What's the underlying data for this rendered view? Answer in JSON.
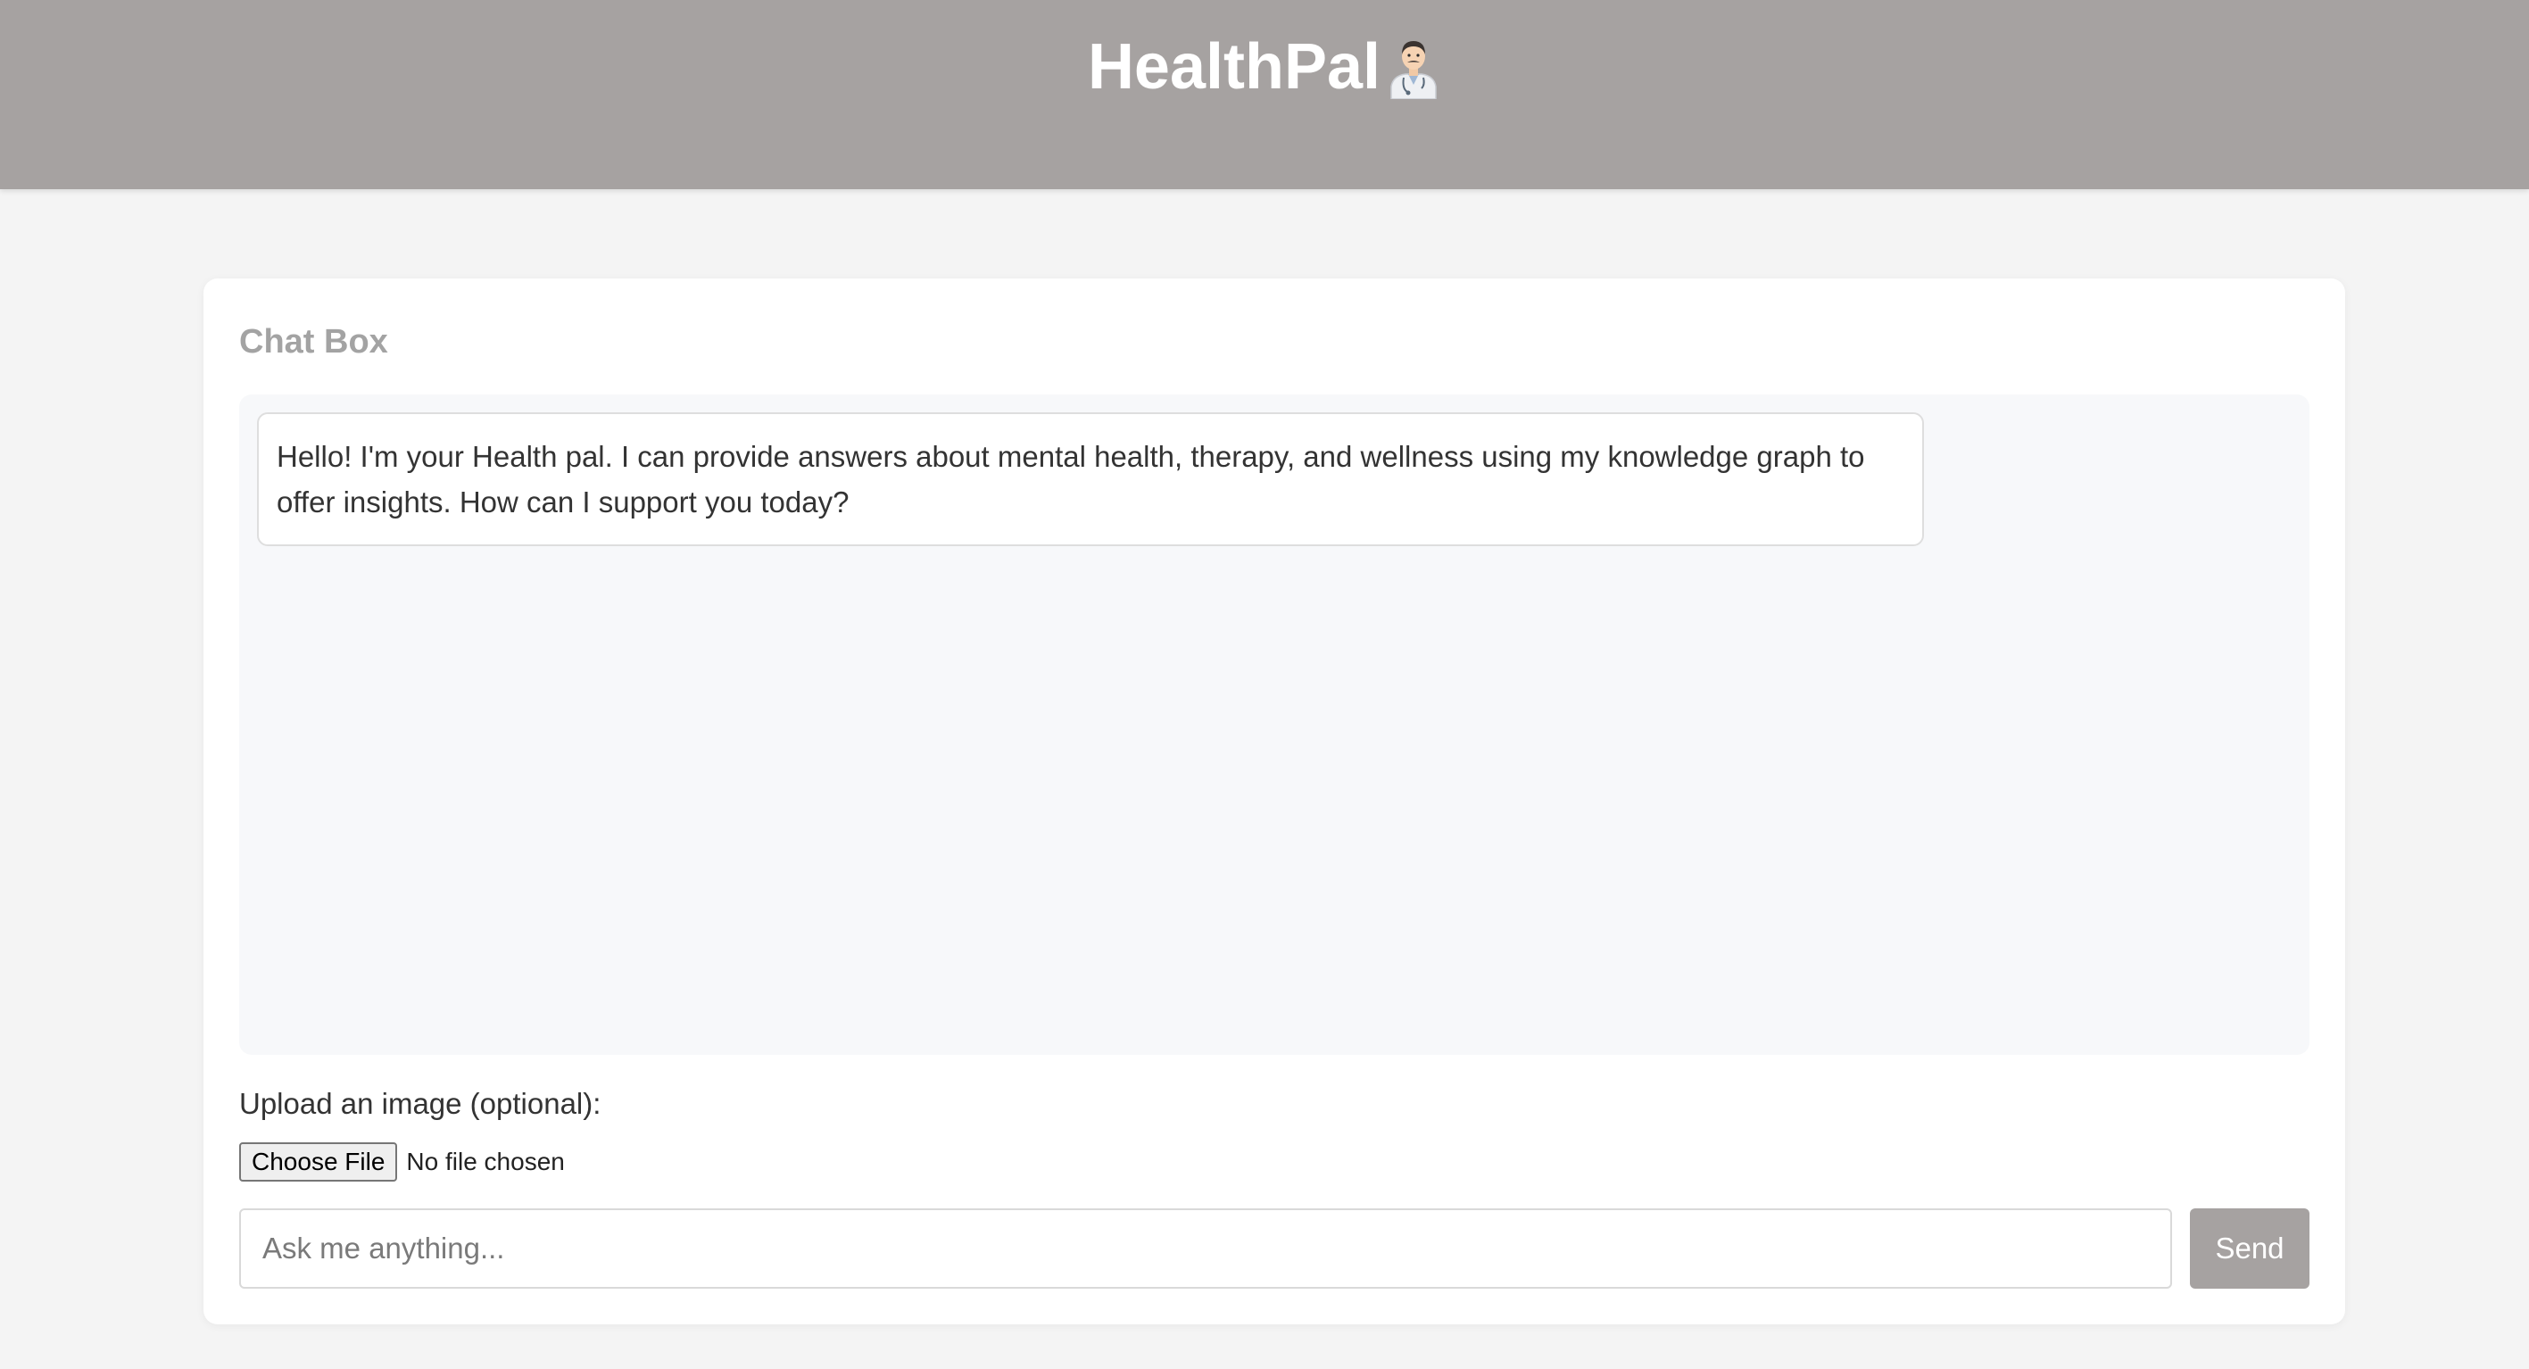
{
  "header": {
    "title": "HealthPal",
    "icon": "doctor-icon",
    "background_color": "#a6a2a1"
  },
  "chat": {
    "title": "Chat Box",
    "messages": [
      {
        "role": "bot",
        "text": "Hello! I'm your Health pal. I can provide answers about mental health, therapy, and wellness using my knowledge graph to offer insights. How can I support you today?"
      }
    ]
  },
  "upload": {
    "label": "Upload an image (optional):",
    "button_label": "Choose File",
    "status": "No file chosen"
  },
  "composer": {
    "placeholder": "Ask me anything...",
    "value": "",
    "send_label": "Send"
  }
}
